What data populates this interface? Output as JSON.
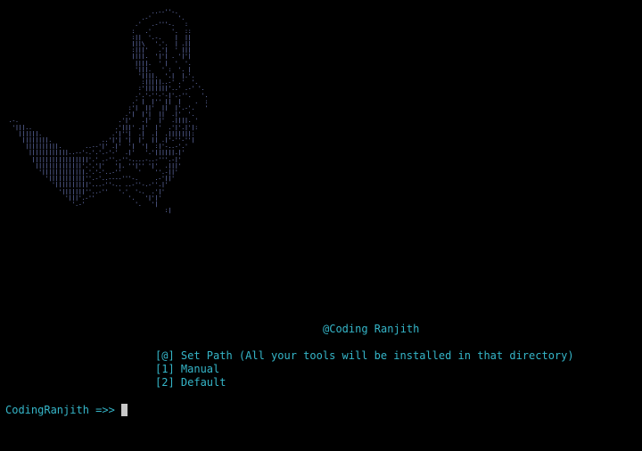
{
  "art": {
    "lines": [
      "                                            ..--''-.",
      "                                         .-'        '.",
      "                                       .'   .-'''-.   :",
      "                                      :   .'      '.  ::",
      "                                      :||  '.-.    |  ||",
      "                                      |||\\   '.'.  | .||",
      "                                      :|||'   .'|  ' |||",
      "                                      ||||.  '|'| . '|'|",
      "                                       ||||.  ' |  '  '.",
      "                                       '|||.   ' :  '. |",
      "                                        '||||.  '.|  |.'.",
      "                                         :|||||..-' .'  '.",
      "                                        :'|||||||'..' .-' '.",
      "                                       .'.'-''-'-|'.-''.   '.",
      "                                      .' |  |'' ||  |    .  :",
      "                                     :'|  ||'  ||  |'.-'.   '",
      "                                    .'|  |'|  ||  .|'  '.  ",
      " .-.                              .'|'   .|'  |'  .||||. '",
      "  '|||..                         .'|||' .|'  |'  .'|'.|'|:",
      "    ||||||.                     .'|''|  .|  .|  .|||||||:",
      "     ||||||||.               ..'|'| '|  |'  || .|'-''-''|",
      "      ||||||||||.       ..--'|' .|'  '|  '|  :|'-..-'.'",
      "       ||||||||||||..--'-.'.'.-'-'  .|'   '.'||||||.|'",
      "        |||||||||||||||||'.' .-''.-''-....-..-'''.-|'",
      "         ||||||||||||||'.'.'|'   '|. ''|'' '|'  .|||'",
      "          '|||||||||||||.'.'-'..-''     '    ''.-||'",
      "            '|||||||||||''.-'..----'''-.     .-'||'",
      "              '||||||||||'...-''-.. ..-''-.-''.|'",
      "                '|||||||''..-''   '.'  '-.  .'|'",
      "                  '|||'.-''          '.   '|'|'",
      "                    '.-'               '.   '|",
      "                                                :|"
    ]
  },
  "credit": "@Coding Ranjith",
  "menu": {
    "title": "[@] Set Path (All your tools will be installed in that directory)",
    "option1": "[1] Manual",
    "option2": "[2] Default"
  },
  "prompt": "CodingRanjith =>>",
  "colors": {
    "background": "#000000",
    "text": "#35b6c9",
    "art": "#7f8ed8",
    "cursor": "#c8c8c8"
  }
}
